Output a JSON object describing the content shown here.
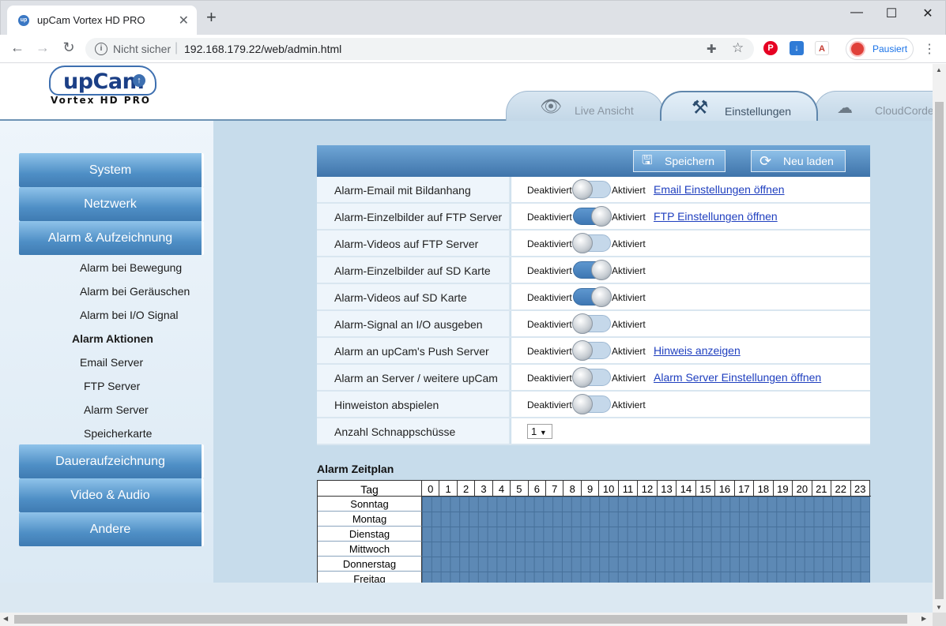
{
  "browser": {
    "tab_title": "upCam Vortex HD PRO",
    "favicon_text": "up",
    "security_label": "Nicht sicher",
    "url": "192.168.179.22/web/admin.html",
    "profile_label": "Pausiert"
  },
  "header": {
    "logo_text": "upCam",
    "logo_subtitle": "Vortex HD PRO",
    "tabs": [
      {
        "label": "Live Ansicht",
        "icon": "eye-icon"
      },
      {
        "label": "Einstellungen",
        "icon": "tools-icon"
      },
      {
        "label": "CloudCorder",
        "icon": "cloud-icon"
      }
    ]
  },
  "sidebar": {
    "main_items": [
      "System",
      "Netzwerk",
      "Alarm & Aufzeichnung",
      "Daueraufzeichnung",
      "Video & Audio",
      "Andere"
    ],
    "sub_items": [
      "Alarm bei Bewegung",
      "Alarm bei Geräuschen",
      "Alarm bei I/O Signal",
      "Alarm Aktionen",
      "Email Server",
      "FTP Server",
      "Alarm Server",
      "Speicherkarte"
    ],
    "active_sub": "Alarm Aktionen"
  },
  "panel": {
    "save_label": "Speichern",
    "reload_label": "Neu laden",
    "off_label": "Deaktiviert",
    "on_label": "Aktiviert"
  },
  "settings": [
    {
      "label": "Alarm-Email mit Bildanhang",
      "on": false,
      "link": "Email Einstellungen öffnen"
    },
    {
      "label": "Alarm-Einzelbilder auf FTP Server",
      "on": true,
      "link": "FTP Einstellungen öffnen"
    },
    {
      "label": "Alarm-Videos auf FTP Server",
      "on": false,
      "link": ""
    },
    {
      "label": "Alarm-Einzelbilder auf SD Karte",
      "on": true,
      "link": ""
    },
    {
      "label": "Alarm-Videos auf SD Karte",
      "on": true,
      "link": ""
    },
    {
      "label": "Alarm-Signal an I/O ausgeben",
      "on": false,
      "link": ""
    },
    {
      "label": "Alarm an upCam's Push Server",
      "on": false,
      "link": "Hinweis anzeigen"
    },
    {
      "label": "Alarm an Server / weitere upCam",
      "on": false,
      "link": "Alarm Server Einstellungen öffnen"
    },
    {
      "label": "Hinweiston abspielen",
      "on": false,
      "link": ""
    }
  ],
  "snapshot": {
    "label": "Anzahl Schnappschüsse",
    "value": "1"
  },
  "schedule": {
    "title": "Alarm Zeitplan",
    "day_header": "Tag",
    "hours": [
      "0",
      "1",
      "2",
      "3",
      "4",
      "5",
      "6",
      "7",
      "8",
      "9",
      "10",
      "11",
      "12",
      "13",
      "14",
      "15",
      "16",
      "17",
      "18",
      "19",
      "20",
      "21",
      "22",
      "23"
    ],
    "days": [
      "Sonntag",
      "Montag",
      "Dienstag",
      "Mittwoch",
      "Donnerstag",
      "Freitag"
    ],
    "active_color": "#5d89b5"
  }
}
